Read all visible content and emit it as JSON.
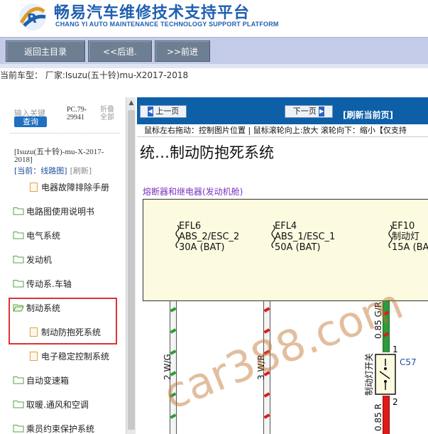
{
  "header": {
    "title": "畅易汽车维修技术支持平台",
    "subtitle": "CHANG YI AUTO MAINTENANCE TECHNOLOGY SUPPORT PLATFORM",
    "brand_color": "#1f5fb0"
  },
  "nav": {
    "back_main": "返回主目录",
    "back": "<<后退.",
    "forward": ">>前进"
  },
  "car_type": "当前车型：  厂家:Isuzu(五十铃)mu-X2017-2018",
  "sidebar": {
    "keyword_label": "输入关键",
    "query_label": "查询",
    "pc_info": "PC.79-29941",
    "fold_label": "折叠全部",
    "car_info": "[Isuzu(五十铃)-mu-X-2017-2018]",
    "current": "[当前：线路图]",
    "refresh": "[刷新]",
    "items": [
      {
        "label": "电器故障排除手册",
        "type": "doc"
      },
      {
        "label": "电路图使用说明书",
        "type": "folder"
      },
      {
        "label": "电气系统",
        "type": "folder"
      },
      {
        "label": "发动机",
        "type": "folder"
      },
      {
        "label": "传动系.车轴",
        "type": "folder"
      },
      {
        "label": "制动系统",
        "type": "folder-open"
      },
      {
        "label": "制动防抱死系统",
        "type": "doc"
      },
      {
        "label": "电子稳定控制系统",
        "type": "doc"
      },
      {
        "label": "自动变速箱",
        "type": "folder"
      },
      {
        "label": "取暖.通风和空调",
        "type": "folder"
      },
      {
        "label": "乘员约束保护系统",
        "type": "folder"
      }
    ]
  },
  "viewer": {
    "prev_page": "上一页",
    "next_page": "下一页",
    "refresh_page": "[刷新当前页]",
    "hint": "鼠标左右拖动：控制图片位置 | 鼠标滚轮向上:放大  滚轮向下：缩小【仅支持",
    "diagram_title": "统…制动防抱死系统",
    "section_label": "熔断器和继电器(发动机舱)",
    "fuses": [
      {
        "name": "EFL6",
        "desc": "ABS_2/ESC_2",
        "rating": "30A (BAT)"
      },
      {
        "name": "EFL4",
        "desc": "ABS_1/ESC_1",
        "rating": "50A (BAT)"
      },
      {
        "name": "EF10",
        "desc": "制动灯",
        "rating": "15A (BA"
      }
    ],
    "wire_labels": [
      "2 W/G",
      "3 W/R",
      "0.85 G/R",
      "0.85 R"
    ],
    "switch_label": "制动灯开关",
    "connector": "C57",
    "pin_1": "1",
    "pin_2": "2",
    "watermark": "car388.com"
  }
}
